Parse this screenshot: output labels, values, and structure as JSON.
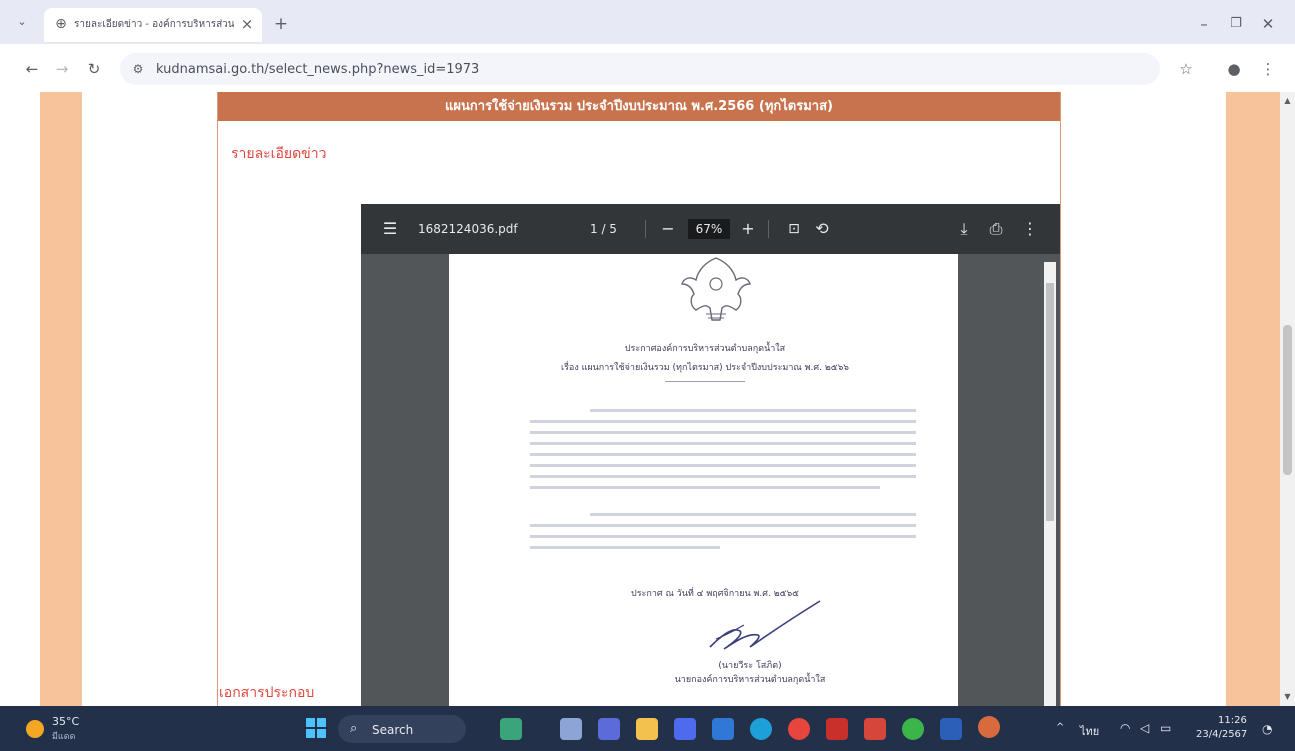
{
  "browser": {
    "tab_title": "รายละเอียดข่าว - องค์การบริหารส่วนตำบลกุดน้ำใส",
    "close_tab_glyph": "×",
    "new_tab_glyph": "+",
    "url": "kudnamsai.go.th/select_news.php?news_id=1973"
  },
  "page": {
    "header_title": "แผนการใช้จ่ายเงินรวม ประจำปีงบประมาณ พ.ศ.2566 (ทุกไตรมาส)",
    "news_detail_label": "รายละเอียดข่าว",
    "attachments_label": "เอกสารประกอบ"
  },
  "pdf_viewer": {
    "file_name": "1682124036.pdf",
    "page_indicator": "1 / 5",
    "zoom": "67%",
    "zoom_out_glyph": "−",
    "zoom_in_glyph": "+"
  },
  "document": {
    "issuer": "ประกาศองค์การบริหารส่วนตำบลกุดน้ำใส",
    "subject": "เรื่อง แผนการใช้จ่ายเงินรวม (ทุกไตรมาส) ประจำปีงบประมาณ พ.ศ. ๒๕๖๖",
    "date_line": "ประกาศ ณ วันที่ ๔ พฤศจิกายน พ.ศ. ๒๕๖๕",
    "signer_name": "(นายวีระ โสภิต)",
    "signer_title": "นายกองค์การบริหารส่วนตำบลกุดน้ำใส"
  },
  "taskbar": {
    "weather_temp": "35°C",
    "weather_desc": "มีแดด",
    "search_label": "Search",
    "language": "ไทย",
    "clock_time": "11:26",
    "clock_date": "23/4/2567"
  },
  "colors": {
    "header_bar": "#c8734d",
    "side_band": "#f6c39b",
    "heading_red": "#e0463e",
    "pdf_toolbar": "#323639",
    "taskbar": "#23304a"
  }
}
